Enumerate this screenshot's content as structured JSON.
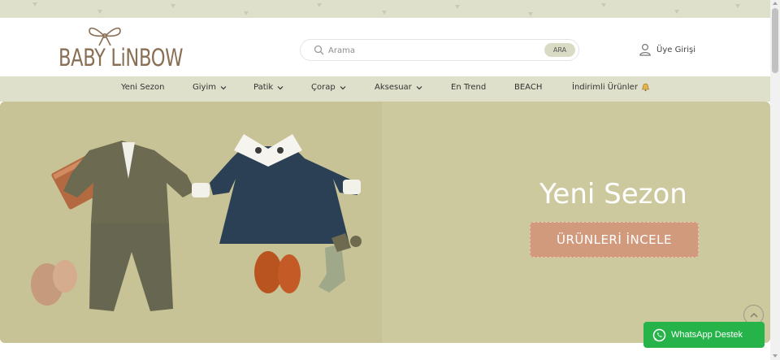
{
  "header": {
    "logo_text": "BABY LiNBOW",
    "search": {
      "placeholder": "Arama",
      "button_label": "ARA",
      "icon": "search-icon"
    },
    "login": {
      "label": "Üye Girişi",
      "icon": "user-icon"
    }
  },
  "nav": {
    "items": [
      {
        "label": "Yeni Sezon",
        "has_dropdown": false
      },
      {
        "label": "Giyim",
        "has_dropdown": true
      },
      {
        "label": "Patik",
        "has_dropdown": true
      },
      {
        "label": "Çorap",
        "has_dropdown": true
      },
      {
        "label": "Aksesuar",
        "has_dropdown": true
      },
      {
        "label": "En Trend",
        "has_dropdown": false
      },
      {
        "label": "BEACH",
        "has_dropdown": false
      },
      {
        "label": "İndirimli Ürünler",
        "has_dropdown": false,
        "icon": "bell-icon"
      }
    ]
  },
  "hero": {
    "title": "Yeni Sezon",
    "cta_label": "ÜRÜNLERİ İNCELE"
  },
  "floating": {
    "whatsapp_label": "WhatsApp Destek",
    "scroll_top_icon": "chevron-up-icon"
  },
  "colors": {
    "strip_bg": "#dfe0cb",
    "hero_bg": "#cdc99e",
    "cta_bg": "#d29a7d",
    "whatsapp_bg": "#25b34a",
    "logo_color": "#8a6f55"
  }
}
